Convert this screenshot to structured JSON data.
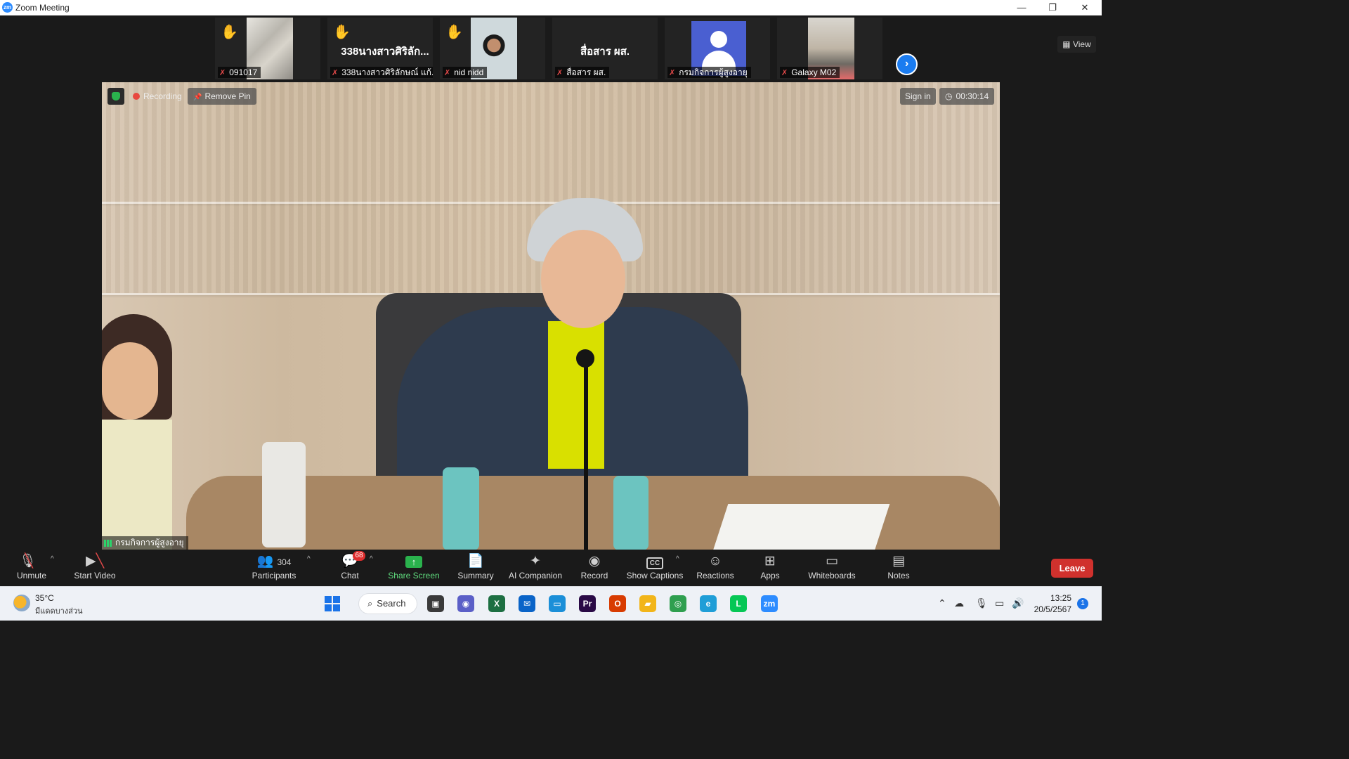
{
  "window": {
    "app_icon": "zm",
    "title": "Zoom Meeting",
    "minimize": "—",
    "restore": "❐",
    "close": "✕"
  },
  "view_button": "▦ View",
  "next_icon": "›",
  "hand_icon": "✋",
  "mic_off_icon": "✗",
  "participants_strip": [
    {
      "name": "091017",
      "hand": true,
      "thumb": "photo"
    },
    {
      "name": "338นางสาวศิริลักษณ์ แก้...",
      "display": "338นางสาวศิริลัก...",
      "hand": true,
      "thumb": "none"
    },
    {
      "name": "nid nidd",
      "hand": true,
      "thumb": "photo"
    },
    {
      "name": "สื่อสาร ผส.",
      "display": "สื่อสาร ผส.",
      "hand": false,
      "thumb": "none"
    },
    {
      "name": "กรมกิจการผู้สูงอายุ",
      "hand": false,
      "thumb": "avatar"
    },
    {
      "name": "Galaxy M02",
      "hand": false,
      "thumb": "photo"
    }
  ],
  "stage": {
    "recording": "Recording",
    "remove_pin": "Remove Pin",
    "sign_in": "Sign in",
    "timer": "00:30:14",
    "timer_icon": "◷",
    "pin_icon": "📌",
    "speaker_name": "กรมกิจการผู้สูงอายุ"
  },
  "toolbar": {
    "unmute": "Unmute",
    "start_video": "Start Video",
    "participants_count": "304",
    "participants": "Participants",
    "chat": "Chat",
    "chat_badge": "68",
    "share_screen": "Share Screen",
    "summary": "Summary",
    "ai_companion": "AI Companion",
    "record": "Record",
    "show_captions": "Show Captions",
    "reactions": "Reactions",
    "apps": "Apps",
    "whiteboards": "Whiteboards",
    "notes": "Notes",
    "leave": "Leave",
    "caret": "^"
  },
  "taskbar": {
    "temperature": "35°C",
    "weather": "มีแดดบางส่วน",
    "search": "Search",
    "search_icon": "⌕",
    "time": "13:25",
    "date": "20/5/2567",
    "notifications": "1",
    "apps": [
      {
        "name": "task-view",
        "glyph": "▣",
        "color": "#3a3a3a"
      },
      {
        "name": "teams",
        "glyph": "◉",
        "color": "#5b5fc7"
      },
      {
        "name": "excel",
        "glyph": "X",
        "color": "#1d6f42"
      },
      {
        "name": "mail",
        "glyph": "✉",
        "color": "#0a64c8"
      },
      {
        "name": "desktop",
        "glyph": "▭",
        "color": "#1b8fd8"
      },
      {
        "name": "premiere",
        "glyph": "Pr",
        "color": "#2a0a46"
      },
      {
        "name": "office",
        "glyph": "O",
        "color": "#d83b01"
      },
      {
        "name": "explorer",
        "glyph": "▰",
        "color": "#f2b519"
      },
      {
        "name": "chrome",
        "glyph": "◎",
        "color": "#2f9f4f"
      },
      {
        "name": "edge",
        "glyph": "e",
        "color": "#1f9ed7"
      },
      {
        "name": "line",
        "glyph": "L",
        "color": "#06c755"
      },
      {
        "name": "zoom",
        "glyph": "zm",
        "color": "#2d8cff"
      }
    ]
  },
  "colors": {
    "accent": "#2d8cff",
    "leave": "#d0312d",
    "share": "#2ab24d",
    "recording": "#e8473f",
    "mic_off": "#e04848"
  }
}
